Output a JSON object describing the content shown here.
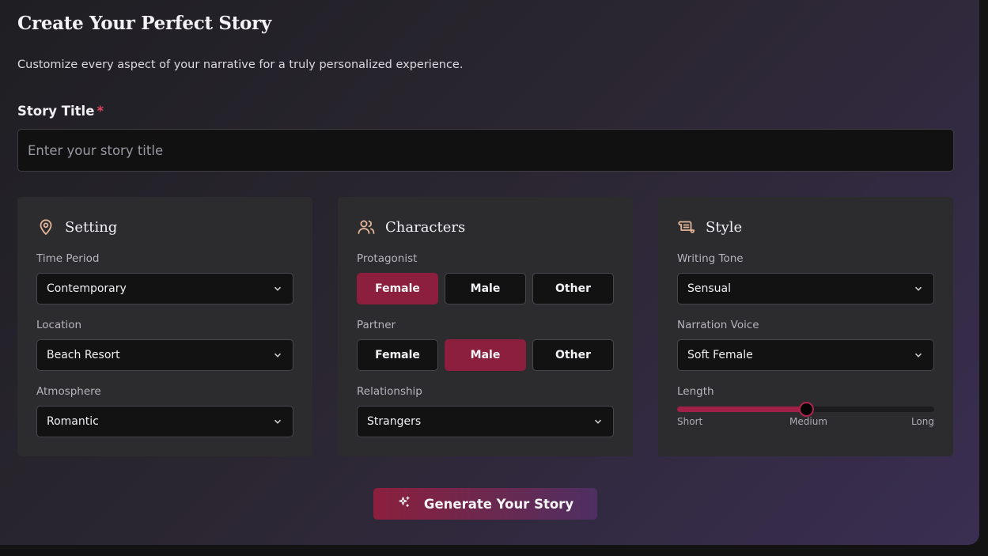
{
  "header": {
    "title": "Create Your Perfect Story",
    "subtitle": "Customize every aspect of your narrative for a truly personalized experience."
  },
  "story_title": {
    "label": "Story Title",
    "required_mark": "*",
    "placeholder": "Enter your story title",
    "value": ""
  },
  "setting": {
    "title": "Setting",
    "icon": "map-pin-icon",
    "time_period": {
      "label": "Time Period",
      "value": "Contemporary"
    },
    "location": {
      "label": "Location",
      "value": "Beach Resort"
    },
    "atmosphere": {
      "label": "Atmosphere",
      "value": "Romantic"
    }
  },
  "characters": {
    "title": "Characters",
    "icon": "users-icon",
    "protagonist": {
      "label": "Protagonist",
      "options": [
        "Female",
        "Male",
        "Other"
      ],
      "selected": "Female"
    },
    "partner": {
      "label": "Partner",
      "options": [
        "Female",
        "Male",
        "Other"
      ],
      "selected": "Male"
    },
    "relationship": {
      "label": "Relationship",
      "value": "Strangers"
    }
  },
  "style": {
    "title": "Style",
    "icon": "scroll-icon",
    "writing_tone": {
      "label": "Writing Tone",
      "value": "Sensual"
    },
    "narration_voice": {
      "label": "Narration Voice",
      "value": "Soft Female"
    },
    "length": {
      "label": "Length",
      "ticks": [
        "Short",
        "Medium",
        "Long"
      ],
      "value": "Medium",
      "fraction": 0.5
    }
  },
  "generate_button": {
    "label": "Generate Your Story",
    "icon": "sparkles-icon"
  },
  "colors": {
    "accent": "#8c1f3d",
    "icon_tint": "#e3b69a",
    "required": "#e0475c"
  }
}
